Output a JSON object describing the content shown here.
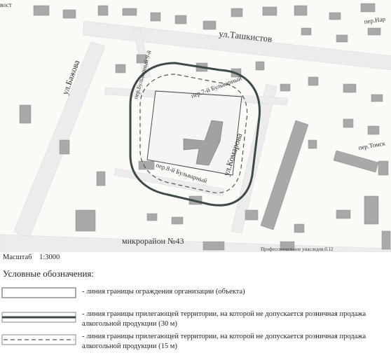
{
  "map": {
    "streets": [
      {
        "id": "tashkistov",
        "label": "ул.Ташкистов"
      },
      {
        "id": "bazhova",
        "label": "ул.Бажова"
      },
      {
        "id": "komarova",
        "label": "ул.Комарова"
      },
      {
        "id": "bulv9",
        "label": "пер.Бульварный 9-й"
      },
      {
        "id": "bulv7",
        "label": "пер.7-й Бульварный"
      },
      {
        "id": "bulv8",
        "label": "пер.8-й Бульварный"
      },
      {
        "id": "tomsk",
        "label": "пер.Томск"
      },
      {
        "id": "nar",
        "label": "пер.Нар"
      },
      {
        "id": "vost",
        "label": "вост"
      }
    ],
    "district_label": "микрорайон №43",
    "watermark": "Профессиональное унаследов.0.12"
  },
  "scale": {
    "label": "Масштаб",
    "value": "1:3000"
  },
  "legend": {
    "title": "Условные обозначения:",
    "items": [
      {
        "type": "fence",
        "text": "- линия границы ограждения организации (объекта)"
      },
      {
        "type": "solid",
        "text": "- линия границы прилегающей территории, на которой не допускается розничная продажа алкогольной продукции (30 м)"
      },
      {
        "type": "dashed",
        "text": "- линия границы прилегающей территории, на которой не допускается розничная продажа алкогольной продукции (15 м)"
      }
    ]
  },
  "colors": {
    "building": "#a9a9a9",
    "boundary": "#3d4a45",
    "road": "#ececec",
    "block": "#f2f2ed"
  }
}
